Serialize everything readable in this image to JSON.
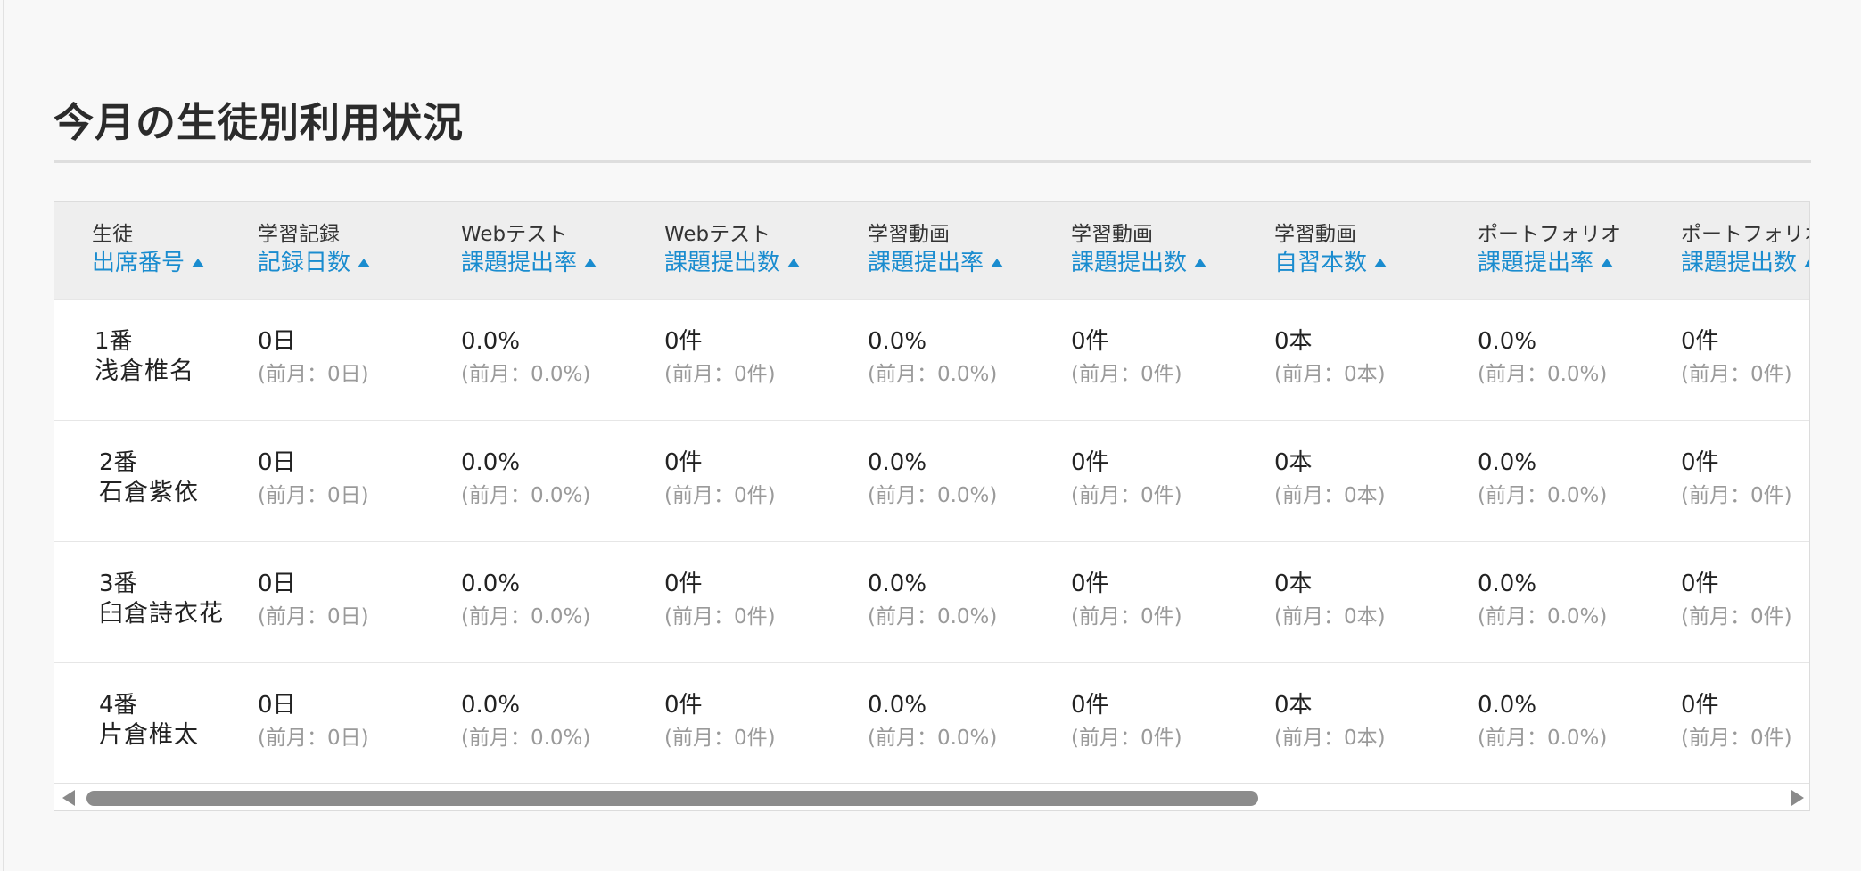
{
  "page": {
    "title": "今月の生徒別利用状況"
  },
  "table": {
    "columns": [
      {
        "top": "生徒",
        "sort_label": "出席番号"
      },
      {
        "top": "学習記録",
        "sort_label": "記録日数"
      },
      {
        "top": "Webテスト",
        "sort_label": "課題提出率"
      },
      {
        "top": "Webテスト",
        "sort_label": "課題提出数"
      },
      {
        "top": "学習動画",
        "sort_label": "課題提出率"
      },
      {
        "top": "学習動画",
        "sort_label": "課題提出数"
      },
      {
        "top": "学習動画",
        "sort_label": "自習本数"
      },
      {
        "top": "ポートフォリオ",
        "sort_label": "課題提出率"
      },
      {
        "top": "ポートフォリオ",
        "sort_label": "課題提出数"
      }
    ],
    "rows": [
      {
        "number": "1番",
        "name": "浅倉椎名",
        "cells": [
          {
            "value": "0日",
            "prev": "(前月：0日)"
          },
          {
            "value": "0.0%",
            "prev": "(前月：0.0%)"
          },
          {
            "value": "0件",
            "prev": "(前月：0件)"
          },
          {
            "value": "0.0%",
            "prev": "(前月：0.0%)"
          },
          {
            "value": "0件",
            "prev": "(前月：0件)"
          },
          {
            "value": "0本",
            "prev": "(前月：0本)"
          },
          {
            "value": "0.0%",
            "prev": "(前月：0.0%)"
          },
          {
            "value": "0件",
            "prev": "(前月：0件)"
          }
        ]
      },
      {
        "number": "2番",
        "name": "石倉紫依",
        "cells": [
          {
            "value": "0日",
            "prev": "(前月：0日)"
          },
          {
            "value": "0.0%",
            "prev": "(前月：0.0%)"
          },
          {
            "value": "0件",
            "prev": "(前月：0件)"
          },
          {
            "value": "0.0%",
            "prev": "(前月：0.0%)"
          },
          {
            "value": "0件",
            "prev": "(前月：0件)"
          },
          {
            "value": "0本",
            "prev": "(前月：0本)"
          },
          {
            "value": "0.0%",
            "prev": "(前月：0.0%)"
          },
          {
            "value": "0件",
            "prev": "(前月：0件)"
          }
        ]
      },
      {
        "number": "3番",
        "name": "臼倉詩衣花",
        "cells": [
          {
            "value": "0日",
            "prev": "(前月：0日)"
          },
          {
            "value": "0.0%",
            "prev": "(前月：0.0%)"
          },
          {
            "value": "0件",
            "prev": "(前月：0件)"
          },
          {
            "value": "0.0%",
            "prev": "(前月：0.0%)"
          },
          {
            "value": "0件",
            "prev": "(前月：0件)"
          },
          {
            "value": "0本",
            "prev": "(前月：0本)"
          },
          {
            "value": "0.0%",
            "prev": "(前月：0.0%)"
          },
          {
            "value": "0件",
            "prev": "(前月：0件)"
          }
        ]
      },
      {
        "number": "4番",
        "name": "片倉椎太",
        "cells": [
          {
            "value": "0日",
            "prev": "(前月：0日)"
          },
          {
            "value": "0.0%",
            "prev": "(前月：0.0%)"
          },
          {
            "value": "0件",
            "prev": "(前月：0件)"
          },
          {
            "value": "0.0%",
            "prev": "(前月：0.0%)"
          },
          {
            "value": "0件",
            "prev": "(前月：0件)"
          },
          {
            "value": "0本",
            "prev": "(前月：0本)"
          },
          {
            "value": "0.0%",
            "prev": "(前月：0.0%)"
          },
          {
            "value": "0件",
            "prev": "(前月：0件)"
          }
        ]
      }
    ],
    "sort_icon": "sort-ascending-triangle-icon"
  },
  "scrollbar": {
    "thumb_fraction": 0.69,
    "position_fraction": 0.0,
    "left_icon": "scroll-left-arrow-icon",
    "right_icon": "scroll-right-arrow-icon"
  },
  "colors": {
    "accent": "#1a8ccf",
    "header_bg": "#eeeeee",
    "page_bg": "#f8f8f8",
    "muted_text": "#9a9a9a"
  }
}
